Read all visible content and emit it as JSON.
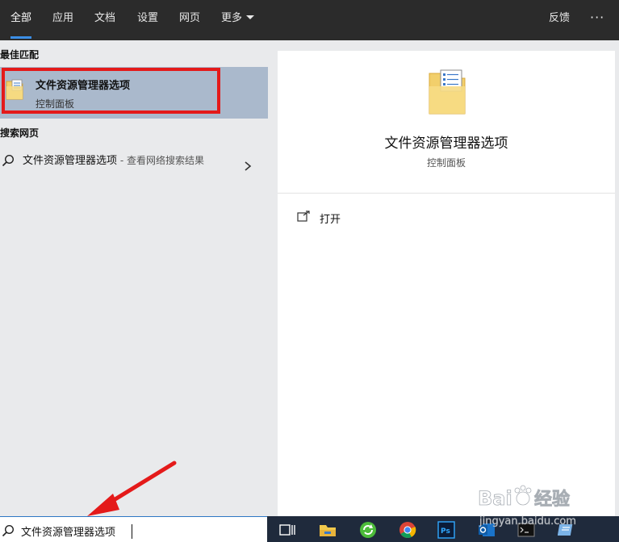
{
  "tabs": [
    {
      "label": "全部",
      "active": true
    },
    {
      "label": "应用"
    },
    {
      "label": "文档"
    },
    {
      "label": "设置"
    },
    {
      "label": "网页"
    },
    {
      "label": "更多"
    }
  ],
  "header_right": {
    "feedback": "反馈",
    "more_dots": "···"
  },
  "best_match": {
    "section_title": "最佳匹配",
    "title": "文件资源管理器选项",
    "subtitle": "控制面板",
    "icon": "folder-options-icon"
  },
  "web_search": {
    "section_title": "搜索网页",
    "query_text": "文件资源管理器选项",
    "suffix": " - 查看网络搜索结果"
  },
  "detail": {
    "title": "文件资源管理器选项",
    "subtitle": "控制面板",
    "actions": [
      {
        "label": "打开",
        "icon": "open-icon"
      }
    ]
  },
  "search_box": {
    "value": "文件资源管理器选项"
  },
  "taskbar_icons": [
    "task-view-icon",
    "file-explorer-icon",
    "refresh-app-icon",
    "chrome-icon",
    "photoshop-icon",
    "outlook-icon",
    "terminal-icon",
    "notes-icon"
  ],
  "watermark": {
    "text1": "Bai",
    "text2": "经验",
    "url": "jingyan.baidu.com"
  },
  "colors": {
    "accent": "#3b8ee6",
    "highlight_border": "#e41a1a",
    "selected_row": "#aab9cc"
  }
}
